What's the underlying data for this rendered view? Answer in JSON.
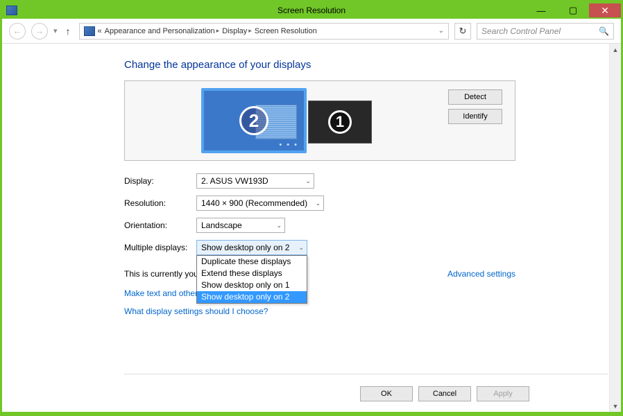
{
  "window": {
    "title": "Screen Resolution"
  },
  "nav": {
    "crumb1": "Appearance and Personalization",
    "crumb2": "Display",
    "crumb3": "Screen Resolution",
    "search_placeholder": "Search Control Panel"
  },
  "heading": "Change the appearance of your displays",
  "preview": {
    "monitor2_num": "2",
    "monitor1_num": "1",
    "detect": "Detect",
    "identify": "Identify"
  },
  "form": {
    "display_label": "Display:",
    "display_value": "2. ASUS VW193D",
    "resolution_label": "Resolution:",
    "resolution_value": "1440 × 900 (Recommended)",
    "orientation_label": "Orientation:",
    "orientation_value": "Landscape",
    "multiple_label": "Multiple displays:",
    "multiple_value": "Show desktop only on 2",
    "options": {
      "o0": "Duplicate these displays",
      "o1": "Extend these displays",
      "o2": "Show desktop only on 1",
      "o3": "Show desktop only on 2"
    }
  },
  "note_partial": "This is currently you",
  "advanced": "Advanced settings",
  "link1_partial": "Make text and other",
  "link2": "What display settings should I choose?",
  "footer": {
    "ok": "OK",
    "cancel": "Cancel",
    "apply": "Apply"
  }
}
